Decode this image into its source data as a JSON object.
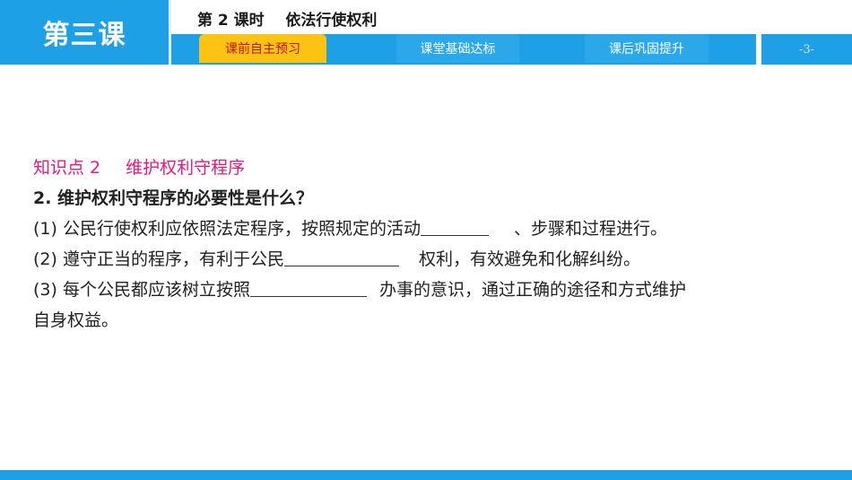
{
  "header": {
    "lesson": "第三课",
    "period_title": "第 2 课时    依法行使权利",
    "tabs": [
      {
        "label": "课前自主预习",
        "active": true
      },
      {
        "label": "课堂基础达标",
        "active": false
      },
      {
        "label": "课后巩固提升",
        "active": false
      }
    ],
    "page_number": "-3-"
  },
  "content": {
    "knowledge_point": "知识点 2",
    "knowledge_title": "维护权利守程序",
    "question": "2. 维护权利守程序的必要性是什么？",
    "item1_before": "(1) 公民行使权利应依照法定程序，按照规定的活动",
    "item1_after": "、步骤和过程进行。",
    "item2_before": "(2) 遵守正当的程序，有利于公民",
    "item2_after": "权利，有效避免和化解纠纷。",
    "item3_before": "(3) 每个公民都应该树立按照",
    "item3_after": "办事的意识，通过正确的途径和方式维护",
    "item3_cont": "自身权益。"
  },
  "colors": {
    "brand_blue": "#1ea0e6",
    "active_tab": "#fcc313",
    "active_tab_text": "#c0151a",
    "accent_pink": "#e5177f"
  }
}
